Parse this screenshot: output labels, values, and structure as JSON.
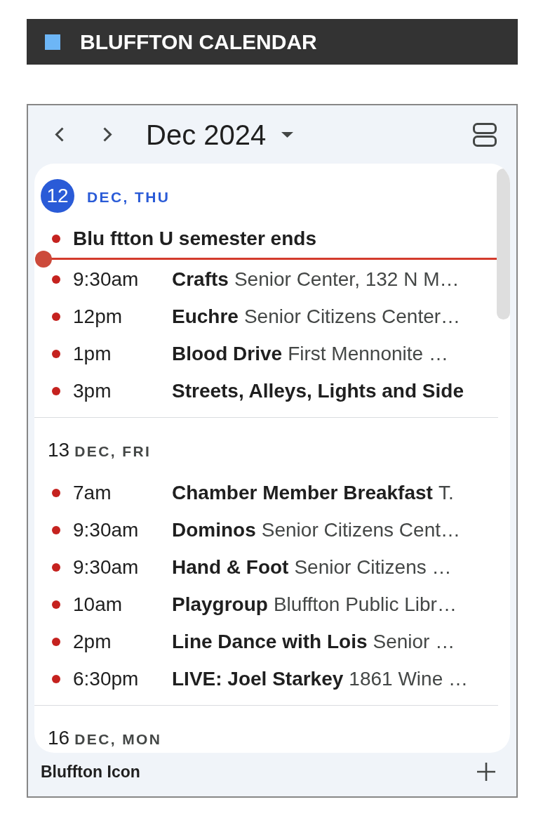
{
  "header": {
    "title": "BLUFFTON CALENDAR"
  },
  "toolbar": {
    "month": "Dec 2024"
  },
  "days": [
    {
      "date": "12",
      "label": "DEC, THU",
      "today": true,
      "events": [
        {
          "kind": "all_day",
          "title": "Blu ftton U semester ends"
        },
        {
          "kind": "now"
        },
        {
          "kind": "timed",
          "time": "9:30am",
          "title": "Crafts",
          "location": "Senior Center, 132 N M…"
        },
        {
          "kind": "timed",
          "time": "12pm",
          "title": "Euchre",
          "location": "Senior Citizens Center…"
        },
        {
          "kind": "timed",
          "time": "1pm",
          "title": "Blood Drive",
          "location": "First Mennonite …"
        },
        {
          "kind": "timed",
          "time": "3pm",
          "title": "Streets, Alleys, Lights and Side"
        }
      ]
    },
    {
      "date": "13",
      "label": "DEC, FRI",
      "today": false,
      "events": [
        {
          "kind": "timed",
          "time": "7am",
          "title": "Chamber Member Breakfast",
          "location": "T."
        },
        {
          "kind": "timed",
          "time": "9:30am",
          "title": "Dominos",
          "location": "Senior Citizens Cent…"
        },
        {
          "kind": "timed",
          "time": "9:30am",
          "title": "Hand & Foot",
          "location": "Senior Citizens …"
        },
        {
          "kind": "timed",
          "time": "10am",
          "title": "Playgroup",
          "location": "Bluffton Public Libr…"
        },
        {
          "kind": "timed",
          "time": "2pm",
          "title": "Line Dance with Lois",
          "location": "Senior …"
        },
        {
          "kind": "timed",
          "time": "6:30pm",
          "title": "LIVE: Joel Starkey",
          "location": "1861 Wine …"
        }
      ]
    },
    {
      "date": "16",
      "label": "DEC, MON",
      "today": false
    }
  ],
  "footer": {
    "label": "Bluffton Icon"
  }
}
